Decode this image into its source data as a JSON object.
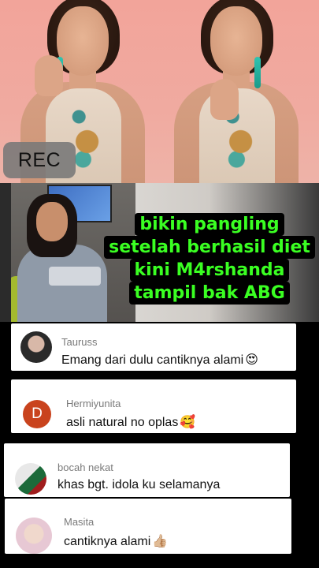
{
  "rec_badge": "REC",
  "caption": {
    "lines": [
      "bikin pangling",
      "setelah berhasil diet",
      "kini M4rshanda",
      "tampil bak ABG"
    ]
  },
  "comments": [
    {
      "username": "Tauruss",
      "text": "Emang dari dulu cantiknya alami",
      "emoji": "😍",
      "avatar": "photo"
    },
    {
      "username": "Hermiyunita",
      "text": "asli natural no oplas",
      "emoji": "🥰",
      "avatar": "D",
      "avatar_color": "#c9431d"
    },
    {
      "username": "bocah nekat",
      "text": "khas bgt. idola ku selamanya",
      "emoji": "",
      "avatar": "photo"
    },
    {
      "username": "Masita",
      "text": "cantiknya alami",
      "emoji": "👍🏼",
      "avatar": "photo"
    }
  ],
  "colors": {
    "caption_text": "#3aff22",
    "caption_bg": "#000000",
    "top_background": "#f2a49a",
    "avatar_letter_bg": "#c9431d"
  }
}
